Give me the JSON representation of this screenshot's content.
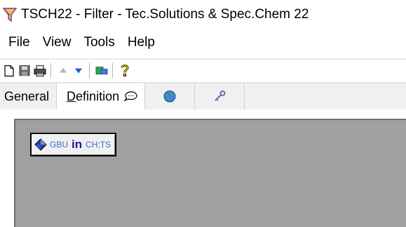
{
  "window": {
    "title": "TSCH22 - Filter - Tec.Solutions & Spec.Chem 22"
  },
  "menu": {
    "items": [
      "File",
      "View",
      "Tools",
      "Help"
    ]
  },
  "toolbar": {
    "buttons": [
      "new-file-icon",
      "save-icon",
      "print-icon",
      "arrow-up-icon",
      "arrow-down-icon",
      "export-icon",
      "help-icon"
    ]
  },
  "tabs": [
    {
      "label": "General"
    },
    {
      "label": "Definition",
      "active": true
    },
    {
      "label": ""
    },
    {
      "label": ""
    },
    {
      "label": ""
    }
  ],
  "filter_badge": {
    "left_code": "GBU",
    "operator": "in",
    "right_code": "CH;TS"
  },
  "colors": {
    "content_bg": "#a0a0a0",
    "code_text": "#3a6cd8",
    "operator_text": "#1c1c9a"
  }
}
